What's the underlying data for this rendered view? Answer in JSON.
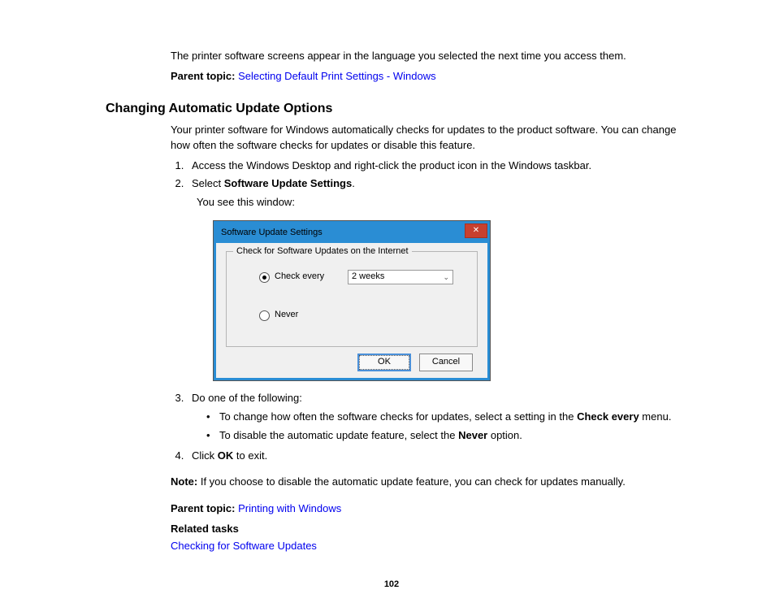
{
  "intro_paragraph": "The printer software screens appear in the language you selected the next time you access them.",
  "parent_topic_label": "Parent topic:",
  "parent_topic_link_1": "Selecting Default Print Settings - Windows",
  "section_heading": "Changing Automatic Update Options",
  "section_intro": "Your printer software for Windows automatically checks for updates to the product software. You can change how often the software checks for updates or disable this feature.",
  "steps": {
    "s1": "Access the Windows Desktop and right-click the product icon in the Windows taskbar.",
    "s2_prefix": "Select ",
    "s2_bold": "Software Update Settings",
    "s2_suffix": ".",
    "s2_follow": "You see this window:",
    "s3": "Do one of the following:",
    "s3_bullet1_prefix": "To change how often the software checks for updates, select a setting in the ",
    "s3_bullet1_bold": "Check every",
    "s3_bullet1_suffix": " menu.",
    "s3_bullet2_prefix": "To disable the automatic update feature, select the ",
    "s3_bullet2_bold": "Never",
    "s3_bullet2_suffix": " option.",
    "s4_prefix": "Click ",
    "s4_bold": "OK",
    "s4_suffix": " to exit."
  },
  "note_label": "Note:",
  "note_text": " If you choose to disable the automatic update feature, you can check for updates manually.",
  "parent_topic_link_2": "Printing with Windows",
  "related_tasks_label": "Related tasks",
  "related_tasks_link": "Checking for Software Updates",
  "page_number": "102",
  "dialog": {
    "title": "Software Update Settings",
    "close_glyph": "✕",
    "group_legend": "Check for Software Updates on the Internet",
    "radio_check_every": "Check every",
    "dropdown_value": "2 weeks",
    "radio_never": "Never",
    "ok": "OK",
    "cancel": "Cancel"
  }
}
